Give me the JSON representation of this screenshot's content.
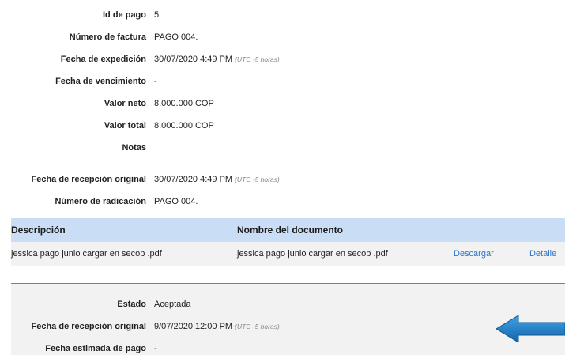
{
  "details": [
    {
      "label": "Id de pago",
      "value": "5",
      "tz": ""
    },
    {
      "label": "Número de factura",
      "value": "PAGO 004.",
      "tz": ""
    },
    {
      "label": "Fecha de expedición",
      "value": "30/07/2020 4:49 PM",
      "tz": "(UTC -5 horas)"
    },
    {
      "label": "Fecha de vencimiento",
      "value": "-",
      "tz": ""
    },
    {
      "label": "Valor neto",
      "value": "8.000.000 COP",
      "tz": ""
    },
    {
      "label": "Valor total",
      "value": "8.000.000 COP",
      "tz": ""
    },
    {
      "label": "Notas",
      "value": "",
      "tz": ""
    },
    {
      "label": "Fecha de recepción original",
      "value": "30/07/2020 4:49 PM",
      "tz": "(UTC -5 horas)"
    },
    {
      "label": "Número de radicación",
      "value": "PAGO 004.",
      "tz": ""
    }
  ],
  "documents": {
    "headers": {
      "description": "Descripción",
      "document_name": "Nombre del documento"
    },
    "rows": [
      {
        "description": "jessica pago junio cargar en secop .pdf",
        "document_name": "jessica pago junio cargar en secop .pdf",
        "download": "Descargar",
        "detail": "Detalle"
      }
    ]
  },
  "status": [
    {
      "label": "Estado",
      "value": "Aceptada",
      "tz": ""
    },
    {
      "label": "Fecha de recepción original",
      "value": "9/07/2020 12:00 PM",
      "tz": "(UTC -5 horas)"
    },
    {
      "label": "Fecha estimada de pago",
      "value": "-",
      "tz": ""
    }
  ],
  "colors": {
    "table_header_bg": "#c9ddf5",
    "row_bg": "#f2f2f2",
    "link": "#2e74c9",
    "divider": "#4a8bd6",
    "arrow": "#1e7fc4"
  },
  "icons": {
    "pointer": "left-arrow-icon"
  }
}
